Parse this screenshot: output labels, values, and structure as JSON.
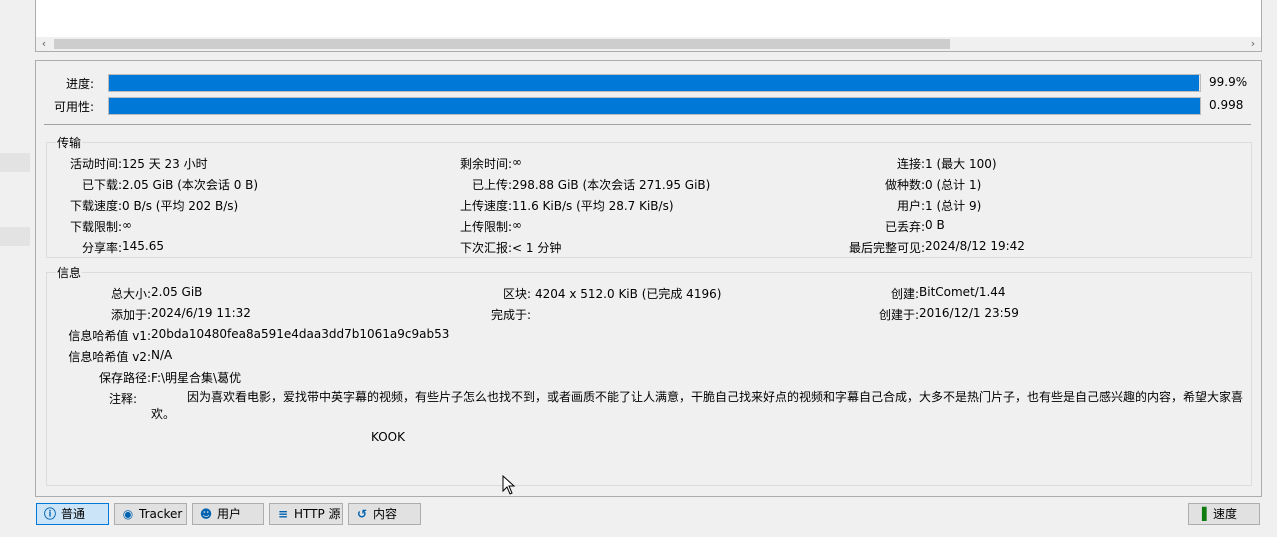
{
  "progress": {
    "label": "进度:",
    "value_text": "99.9%",
    "fraction": 0.999
  },
  "availability": {
    "label": "可用性:",
    "value_text": "0.998",
    "fraction": 1.0
  },
  "transfer": {
    "title": "传输",
    "active_time_label": "活动时间:",
    "active_time": "125 天 23 小时",
    "downloaded_label": "已下载:",
    "downloaded": "2.05 GiB (本次会话 0 B)",
    "dl_speed_label": "下载速度:",
    "dl_speed": "0 B/s (平均 202 B/s)",
    "dl_limit_label": "下载限制:",
    "dl_limit": "∞",
    "share_ratio_label": "分享率:",
    "share_ratio": "145.65",
    "eta_label": "剩余时间:",
    "eta": "∞",
    "uploaded_label": "已上传:",
    "uploaded": "298.88 GiB (本次会话 271.95 GiB)",
    "ul_speed_label": "上传速度:",
    "ul_speed": "11.6 KiB/s (平均 28.7 KiB/s)",
    "ul_limit_label": "上传限制:",
    "ul_limit": "∞",
    "reannounce_label": "下次汇报:",
    "reannounce": "< 1 分钟",
    "connections_label": "连接:",
    "connections": "1 (最大 100)",
    "seeds_label": "做种数:",
    "seeds": "0 (总计 1)",
    "peers_label": "用户:",
    "peers": "1 (总计 9)",
    "wasted_label": "已丢弃:",
    "wasted": "0 B",
    "last_complete_label": "最后完整可见:",
    "last_complete": "2024/8/12 19:42"
  },
  "info": {
    "title": "信息",
    "total_size_label": "总大小:",
    "total_size": "2.05 GiB",
    "added_on_label": "添加于:",
    "added_on": "2024/6/19 11:32",
    "hash_v1_label": "信息哈希值 v1:",
    "hash_v1": "20bda10480fea8a591e4daa3dd7b1061a9c9ab53",
    "hash_v2_label": "信息哈希值 v2:",
    "hash_v2": "N/A",
    "save_path_label": "保存路径:",
    "save_path": "F:\\明星合集\\葛优",
    "comment_label": "注释:",
    "comment_line1": "因为喜欢看电影，爱找带中英字幕的视频，有些片子怎么也找不到，或者画质不能了让人满意，干脆自己找来好点的视频和字幕自己合成，大多不是热门片子，也有些是自己感兴趣的内容，希望大家喜",
    "comment_line2": "欢。",
    "comment_line3": "KOOK",
    "pieces_label": "区块:",
    "pieces": "4204 x 512.0 KiB (已完成 4196)",
    "completed_on_label": "完成于:",
    "completed_on": "",
    "created_by_label": "创建:",
    "created_by": "BitComet/1.44",
    "created_on_label": "创建于:",
    "created_on": "2016/12/1 23:59"
  },
  "tabs": {
    "general": "普通",
    "trackers": "Tracker",
    "peers": "用户",
    "http_sources": "HTTP 源",
    "content": "内容",
    "speed": "速度"
  },
  "icons": {
    "general": "info-icon",
    "trackers": "location-pin-icon",
    "peers": "users-icon",
    "http_sources": "database-icon",
    "content": "folder-link-icon",
    "speed": "bar-chart-icon"
  },
  "colors": {
    "accent": "#0078d7"
  }
}
